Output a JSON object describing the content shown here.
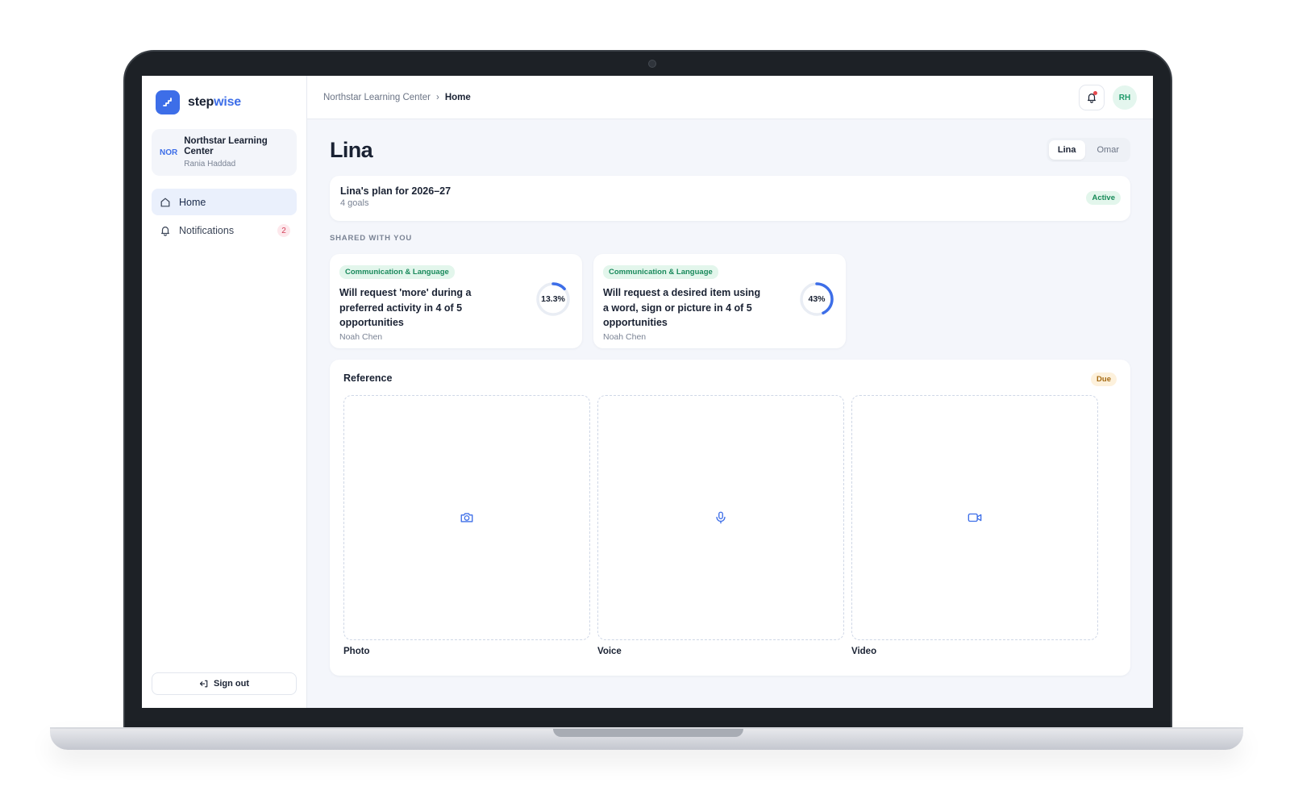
{
  "brand": {
    "name_main": "step",
    "name_accent": "wise"
  },
  "org": {
    "tag": "NOR",
    "name": "Northstar Learning Center",
    "user": "Rania Haddad"
  },
  "nav": {
    "home": "Home",
    "notifications": "Notifications",
    "notifications_count": "2"
  },
  "signout": "Sign out",
  "breadcrumb": {
    "parent": "Northstar Learning Center",
    "separator": "›",
    "current": "Home"
  },
  "avatar_initials": "RH",
  "page": {
    "title": "Lina",
    "switcher": [
      "Lina",
      "Omar"
    ]
  },
  "plan": {
    "title": "Lina's plan for 2026–27",
    "subtitle": "4 goals",
    "status": "Active"
  },
  "section_label": "SHARED WITH YOU",
  "goals": [
    {
      "tag": "Communication & Language",
      "text": "Will request 'more' during a preferred activity in 4 of 5 opportunities",
      "owner": "Noah Chen",
      "progress_label": "13.3%",
      "progress": 13.3
    },
    {
      "tag": "Communication & Language",
      "text": "Will request a desired item using a word, sign or picture in 4 of 5 opportunities",
      "owner": "Noah Chen",
      "progress_label": "43%",
      "progress": 43
    }
  ],
  "reference": {
    "title": "Reference",
    "status": "Due",
    "items": [
      {
        "label": "Photo",
        "icon": "camera-icon"
      },
      {
        "label": "Voice",
        "icon": "microphone-icon"
      },
      {
        "label": "Video",
        "icon": "video-icon"
      }
    ]
  },
  "colors": {
    "accent": "#3d6ee8",
    "success": "#178a58",
    "warning": "#a56a12"
  }
}
